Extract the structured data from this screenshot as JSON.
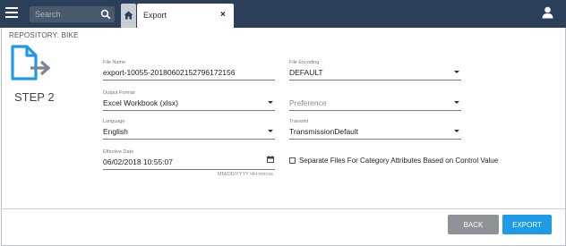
{
  "topbar": {
    "search_placeholder": "Search",
    "tabs": [
      {
        "icon": "home-icon"
      },
      {
        "label": "Export",
        "close": "×"
      }
    ]
  },
  "repository": {
    "label": "REPOSITORY: BIKE"
  },
  "step": {
    "label": "STEP 2"
  },
  "form": {
    "file_name": {
      "label": "File Name",
      "value": "export-10055-20180602152796172156"
    },
    "file_encoding": {
      "label": "File Encoding",
      "value": "DEFAULT"
    },
    "output_format": {
      "label": "Output Format",
      "value": "Excel Workbook (xlsx)"
    },
    "preference": {
      "label": "",
      "placeholder": "Preference"
    },
    "language": {
      "label": "Language",
      "value": "English"
    },
    "transmit": {
      "label": "Transmit",
      "value": "TransmissionDefault"
    },
    "effective_date": {
      "label": "Effective Date",
      "value": "06/02/2018 10:55:07",
      "hint": "MM/DD/YYYY HH:mm:ss"
    },
    "separate_files": {
      "label": "Separate Files For Category Attributes Based on Control Value",
      "checked": false
    }
  },
  "footer": {
    "back_label": "BACK",
    "export_label": "EXPORT"
  },
  "colors": {
    "topbar": "#2b3f58",
    "primary": "#1e9be6",
    "secondary": "#8f9398"
  }
}
